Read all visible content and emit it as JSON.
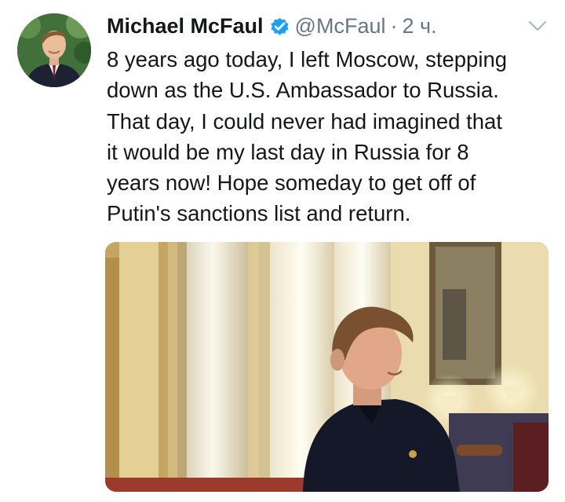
{
  "author": {
    "name": "Michael McFaul",
    "handle": "@McFaul",
    "separator": "·",
    "time": "2 ч.",
    "verified": true,
    "avatar_icon": "profile-photo"
  },
  "tweet": {
    "lines": [
      "8 years ago today, I left Moscow, stepping",
      "down as the U.S. Ambassador to Russia.",
      "That day, I could never had imagined that",
      "it would be my last day in Russia for 8",
      "years now!  Hope someday to get off of",
      "Putin's sanctions list and return."
    ]
  },
  "menu": {
    "icon": "chevron-down-icon"
  },
  "media": {
    "type": "photo"
  },
  "colors": {
    "text": "#14171a",
    "muted": "#657786",
    "verified": "#1da1f2",
    "caret": "#aab8c2"
  }
}
